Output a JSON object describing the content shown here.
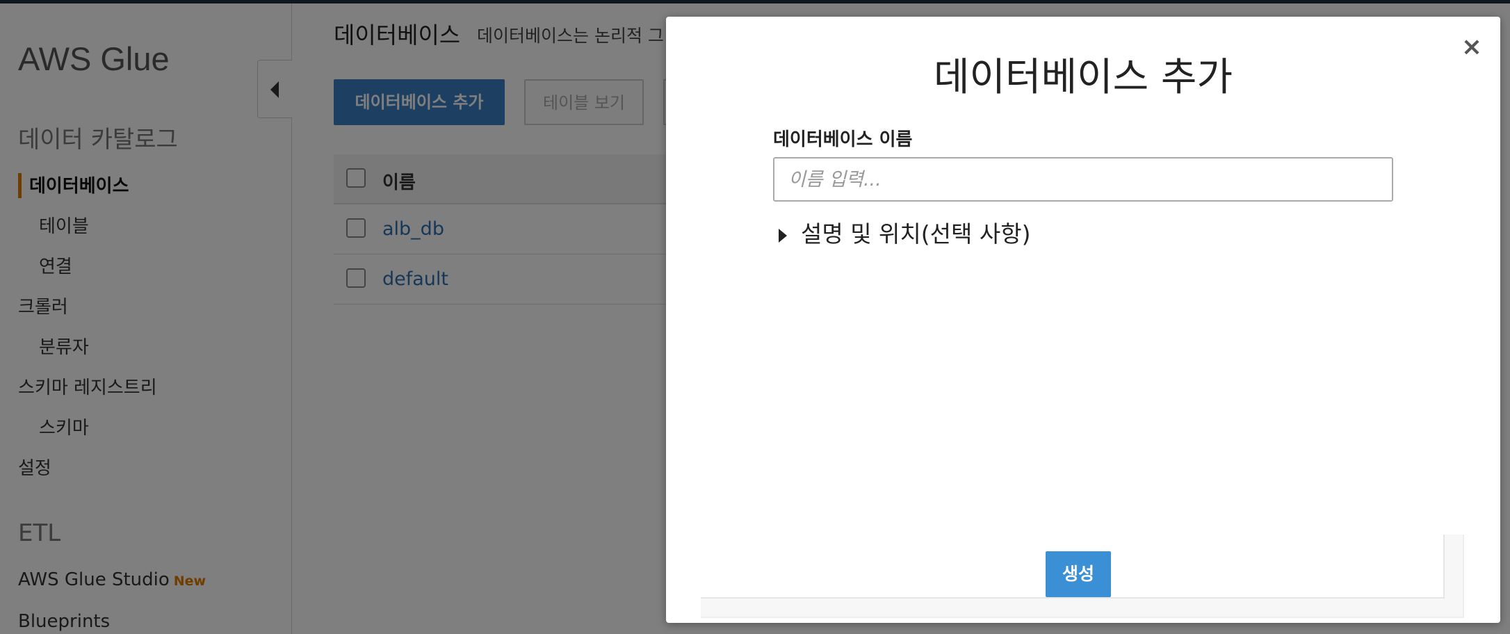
{
  "sidebar": {
    "title": "AWS Glue",
    "section_catalog": "데이터 카탈로그",
    "items": [
      {
        "label": "데이터베이스"
      },
      {
        "label": "테이블"
      },
      {
        "label": "연결"
      },
      {
        "label": "크롤러"
      },
      {
        "label": "분류자"
      },
      {
        "label": "스키마 레지스트리"
      },
      {
        "label": "스키마"
      },
      {
        "label": "설정"
      }
    ],
    "section_etl": "ETL",
    "studio_label": "AWS Glue Studio",
    "studio_badge": "New",
    "blueprints_label": "Blueprints"
  },
  "main": {
    "title": "데이터베이스",
    "description": "데이터베이스는 논리적 그",
    "add_button": "데이터베이스 추가",
    "view_tables_button": "테이블 보기",
    "table": {
      "header_name": "이름",
      "rows": [
        {
          "name": "alb_db"
        },
        {
          "name": "default"
        }
      ]
    }
  },
  "modal": {
    "title": "데이터베이스 추가",
    "close_symbol": "×",
    "name_label": "데이터베이스 이름",
    "name_placeholder": "이름 입력...",
    "name_value": "",
    "expander_label": "설명 및 위치(선택 사항)",
    "create_button": "생성"
  }
}
